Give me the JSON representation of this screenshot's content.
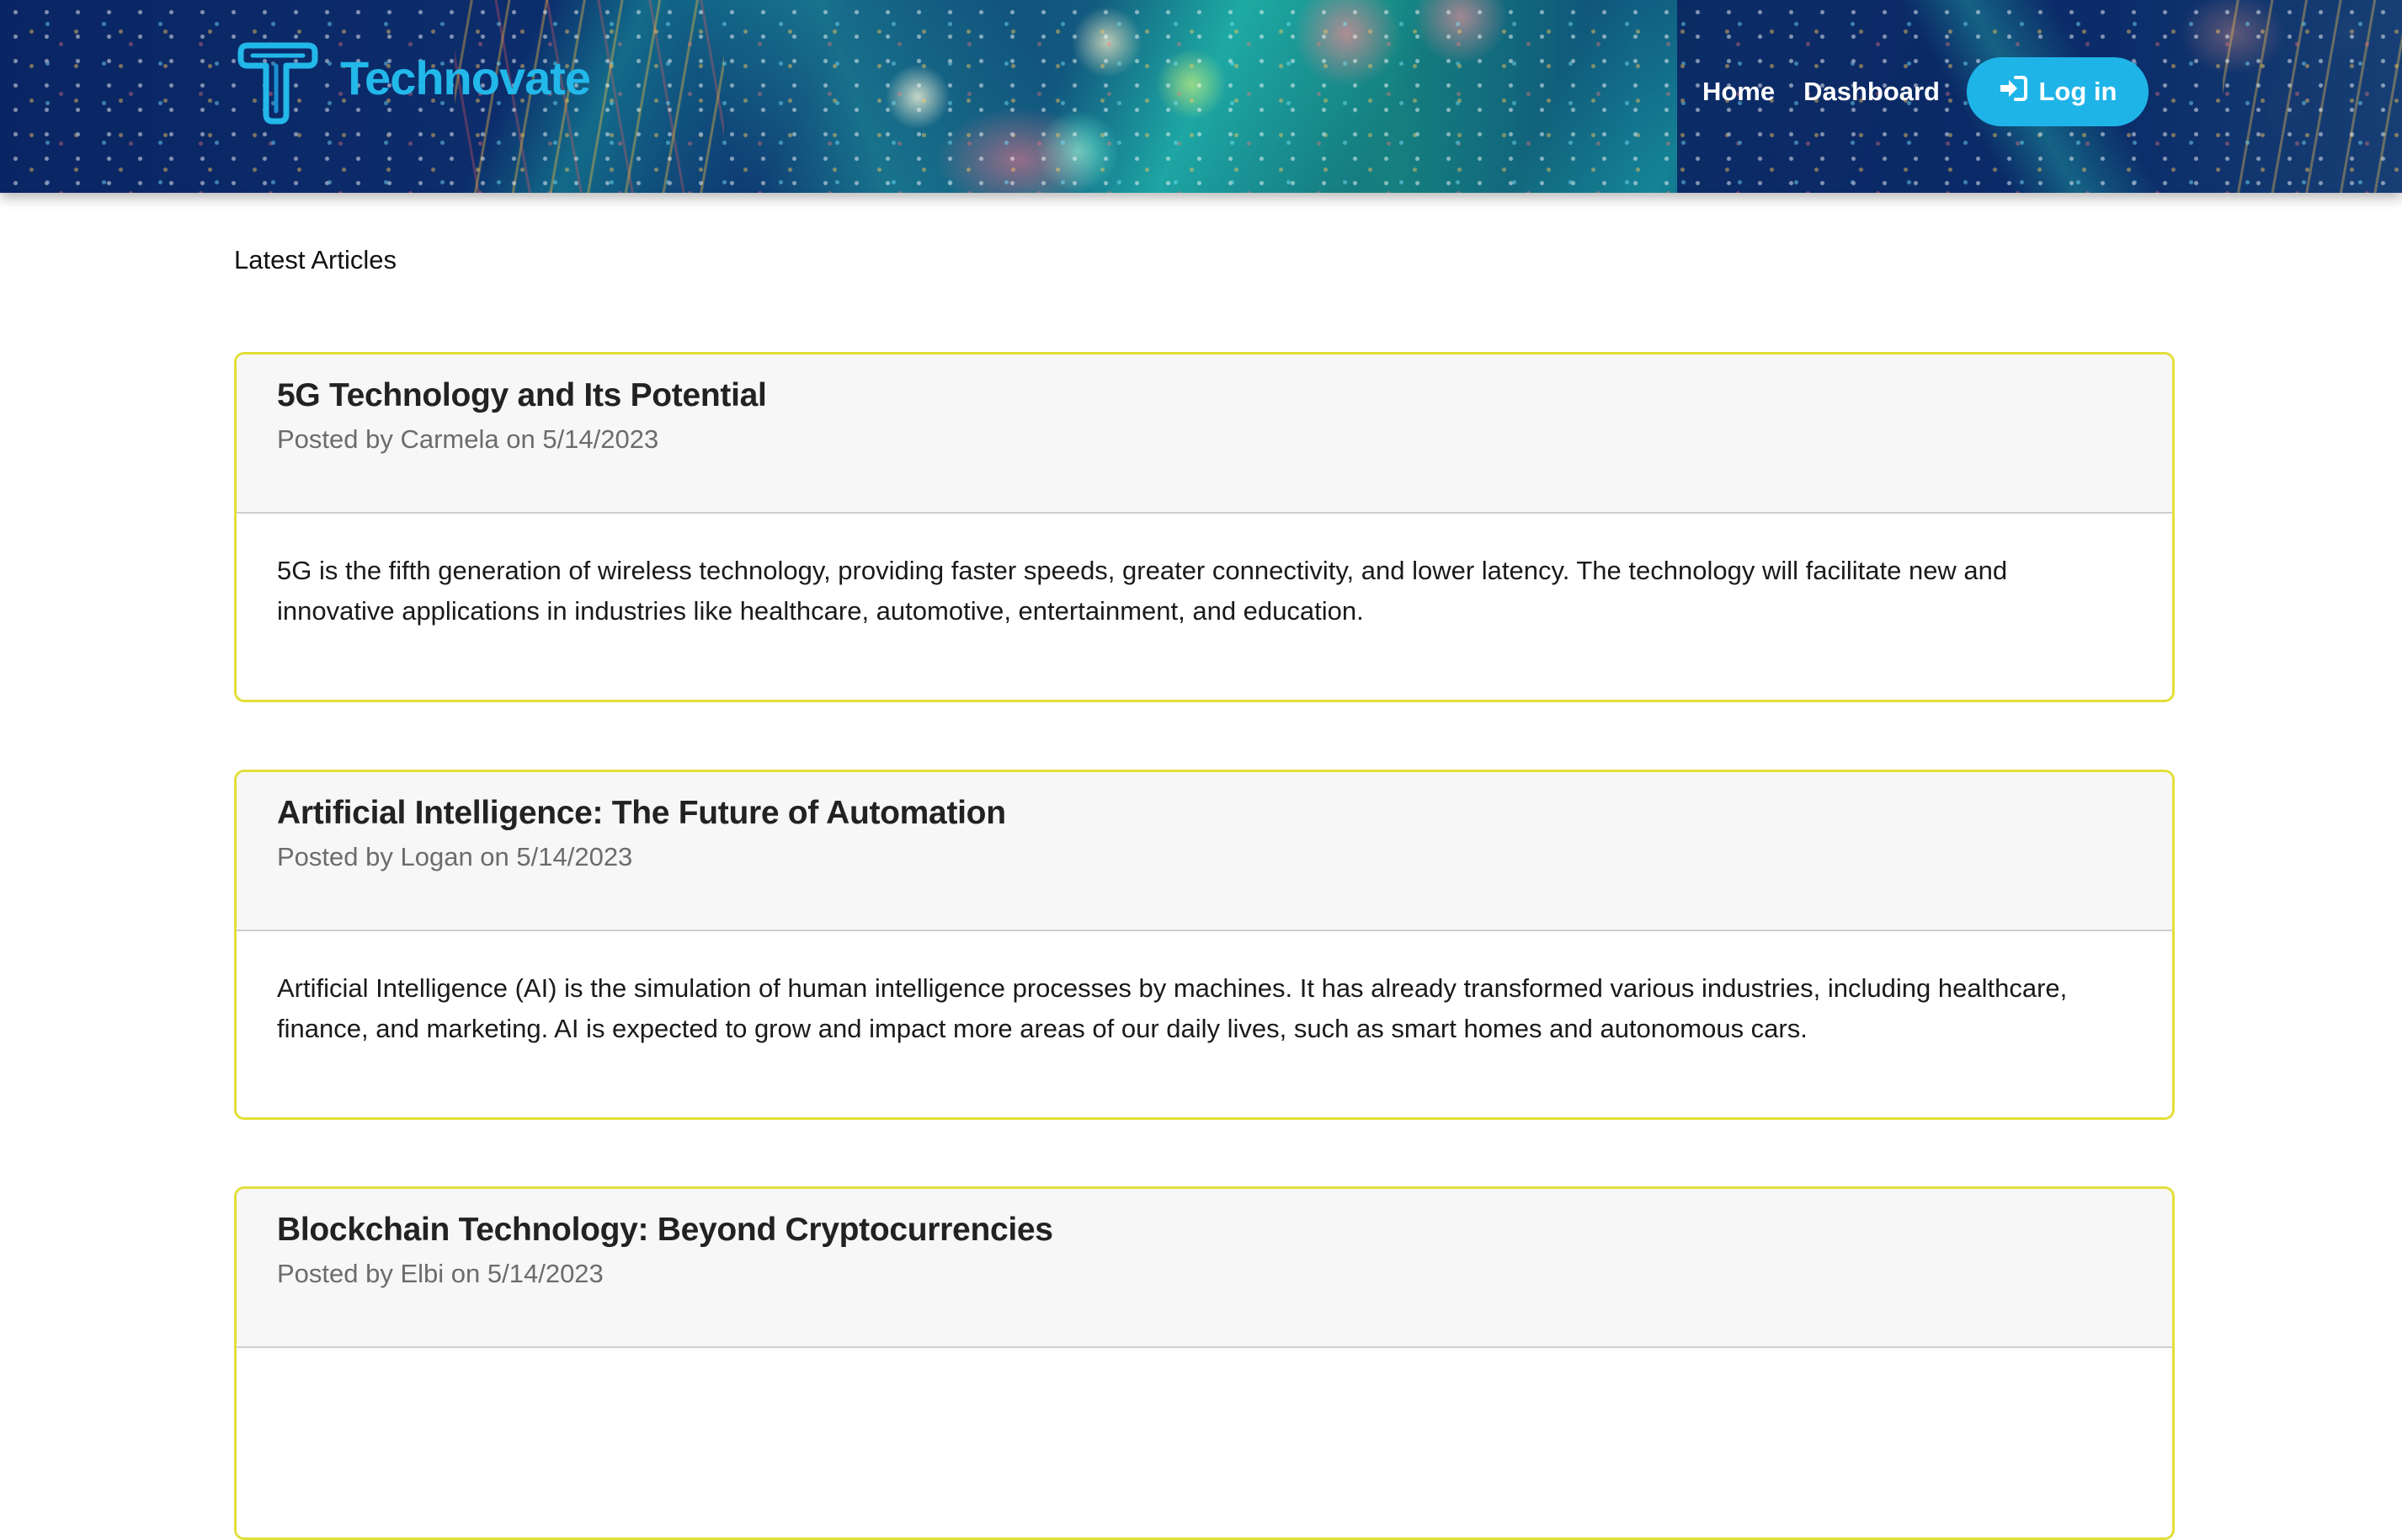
{
  "brand": {
    "name": "Technovate",
    "accent_color": "#22b8ea"
  },
  "nav": {
    "home_label": "Home",
    "dashboard_label": "Dashboard",
    "login_label": "Log in",
    "login_icon": "sign-in-icon"
  },
  "main": {
    "section_title": "Latest Articles",
    "articles": [
      {
        "title": "5G Technology and Its Potential",
        "meta": "Posted by Carmela on 5/14/2023",
        "body": "5G is the fifth generation of wireless technology, providing faster speeds, greater connectivity, and lower latency. The technology will facilitate new and innovative applications in industries like healthcare, automotive, entertainment, and education."
      },
      {
        "title": "Artificial Intelligence: The Future of Automation",
        "meta": "Posted by Logan on 5/14/2023",
        "body": "Artificial Intelligence (AI) is the simulation of human intelligence processes by machines. It has already transformed various industries, including healthcare, finance, and marketing. AI is expected to grow and impact more areas of our daily lives, such as smart homes and autonomous cars."
      },
      {
        "title": "Blockchain Technology: Beyond Cryptocurrencies",
        "meta": "Posted by Elbi on 5/14/2023",
        "body": ""
      }
    ]
  },
  "colors": {
    "card_border": "#e2df3a",
    "card_header_bg": "#f7f7f7",
    "login_button_bg": "#1fb4e8",
    "header_bg": "#0a2563"
  }
}
